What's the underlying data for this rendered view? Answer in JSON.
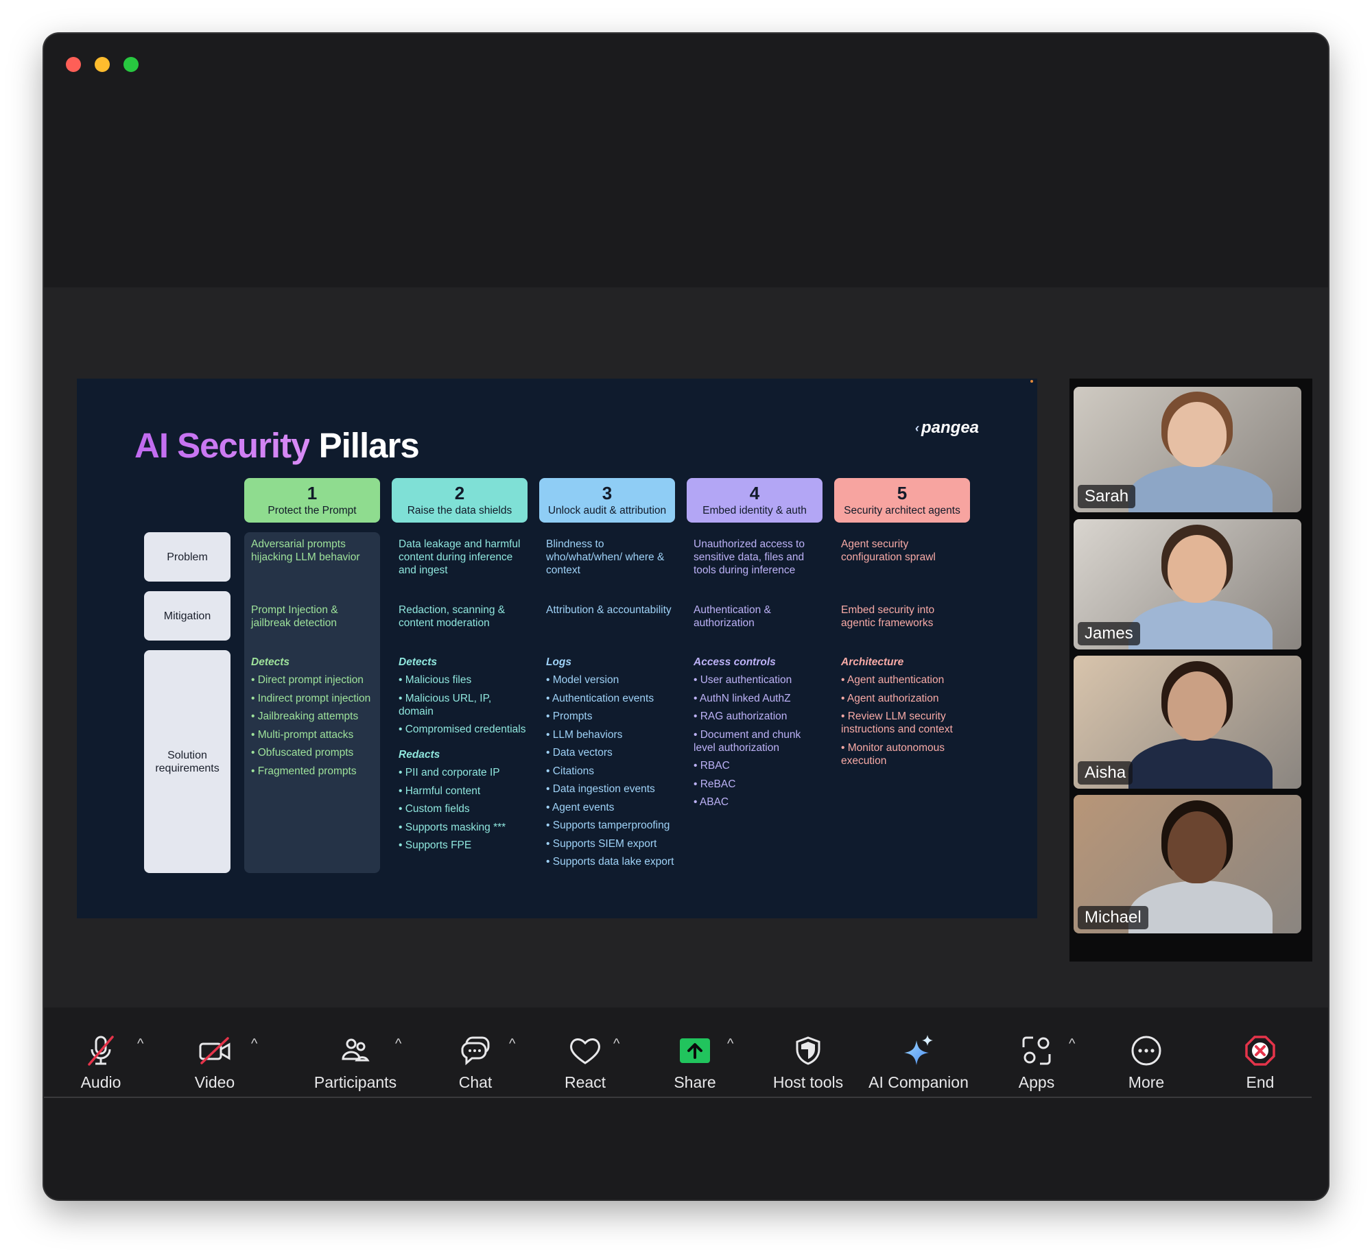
{
  "slide": {
    "title_accent": "AI Security",
    "title_rest": " Pillars",
    "logo": "pangea",
    "row_labels": [
      "Problem",
      "Mitigation",
      "Solution requirements"
    ],
    "pillars": [
      {
        "num": "1",
        "name": "Protect the Prompt",
        "color": "#8fdc8f",
        "text_color": "#9fe39b",
        "problem": "Adversarial prompts hijacking LLM behavior",
        "mitigation": "Prompt Injection & jailbreak detection",
        "sections": [
          {
            "head": "Detects",
            "items": [
              "Direct prompt injection",
              "Indirect prompt injection",
              "Jailbreaking attempts",
              "Multi-prompt attacks",
              "Obfuscated prompts",
              "Fragmented prompts"
            ]
          }
        ]
      },
      {
        "num": "2",
        "name": "Raise the data shields",
        "color": "#7fe0d6",
        "text_color": "#8fe6dd",
        "problem": "Data leakage and harmful content during inference and ingest",
        "mitigation": "Redaction, scanning & content moderation",
        "sections": [
          {
            "head": "Detects",
            "items": [
              "Malicious files",
              "Malicious URL, IP, domain",
              "Compromised credentials"
            ]
          },
          {
            "head": "Redacts",
            "items": [
              "PII and corporate IP",
              "Harmful content",
              "Custom fields",
              "Supports masking ***",
              "Supports FPE"
            ]
          }
        ]
      },
      {
        "num": "3",
        "name": "Unlock audit & attribution",
        "color": "#8fcdf5",
        "text_color": "#9fd2f7",
        "problem": "Blindness to who/what/when/ where & context",
        "mitigation": "Attribution & accountability",
        "sections": [
          {
            "head": "Logs",
            "items": [
              "Model version",
              "Authentication events",
              "Prompts",
              "LLM behaviors",
              "Data vectors",
              "Citations",
              "Data ingestion events",
              "Agent events",
              "Supports tamperproofing",
              "Supports SIEM export",
              "Supports data lake export"
            ]
          }
        ]
      },
      {
        "num": "4",
        "name": "Embed identity & auth",
        "color": "#b3a6f5",
        "text_color": "#bdb2f7",
        "problem": "Unauthorized access to sensitive data, files and tools during inference",
        "mitigation": "Authentication & authorization",
        "sections": [
          {
            "head": "Access controls",
            "items": [
              "User authentication",
              "AuthN  linked AuthZ",
              "RAG authorization",
              "Document and chunk level authorization",
              "RBAC",
              "ReBAC",
              "ABAC"
            ]
          }
        ]
      },
      {
        "num": "5",
        "name": "Security architect agents",
        "color": "#f7a4a0",
        "text_color": "#f7aaa6",
        "problem": "Agent security configuration sprawl",
        "mitigation": "Embed security into agentic frameworks",
        "sections": [
          {
            "head": "Architecture",
            "items": [
              "Agent authentication",
              "Agent authorization",
              "Review LLM security instructions and context",
              "Monitor autonomous execution"
            ]
          }
        ]
      }
    ]
  },
  "participants": [
    {
      "name": "Sarah",
      "wall": "#cfcac2",
      "shirt": "#8da6c6",
      "skin": "#e6bfa4",
      "hair": "#7a4e32"
    },
    {
      "name": "James",
      "wall": "#d9d5cf",
      "shirt": "#9fb6d4",
      "skin": "#e2b596",
      "hair": "#3e2a1e"
    },
    {
      "name": "Aisha",
      "wall": "#d8c4ac",
      "shirt": "#1f2a44",
      "skin": "#caa084",
      "hair": "#2a1a12"
    },
    {
      "name": "Michael",
      "wall": "#b89678",
      "shirt": "#c8ccd2",
      "skin": "#6b4530",
      "hair": "#1c120c"
    }
  ],
  "toolbar": {
    "audio": "Audio",
    "video": "Video",
    "participants": "Participants",
    "chat": "Chat",
    "react": "React",
    "share": "Share",
    "host_tools": "Host tools",
    "ai_companion": "AI Companion",
    "apps": "Apps",
    "more": "More",
    "end": "End"
  },
  "colors": {
    "share_green": "#21c45d",
    "end_red": "#e5344a",
    "mute_red": "#e5344a"
  }
}
